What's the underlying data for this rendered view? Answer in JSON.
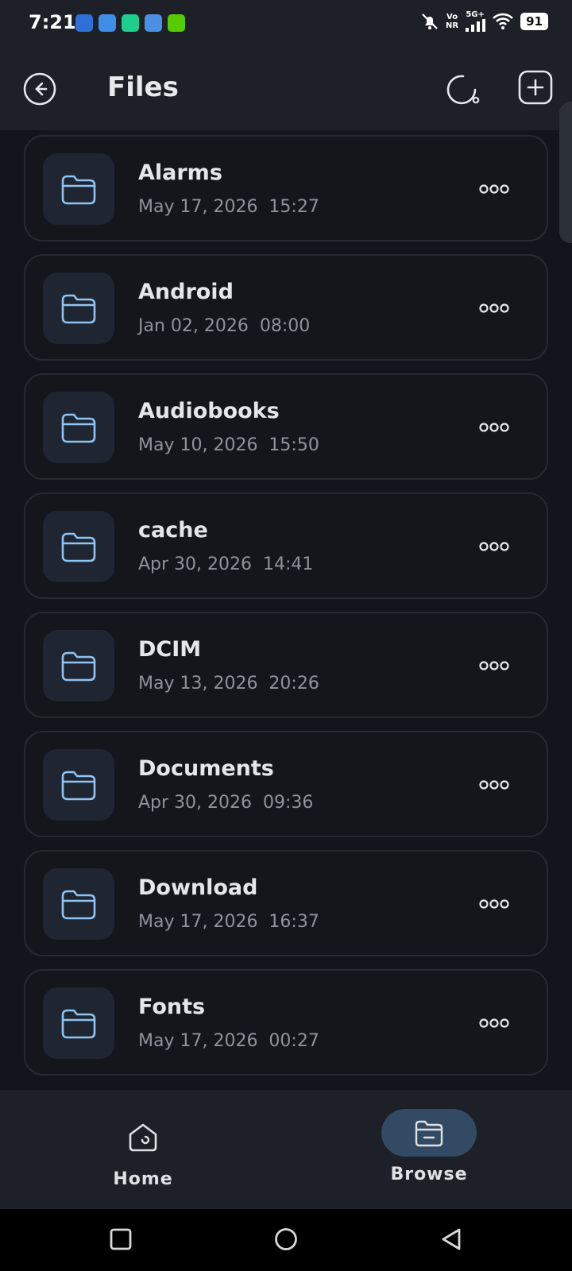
{
  "status_bar": {
    "time": "7:21",
    "notification_icons": [
      {
        "name": "usb-icon",
        "color": "#2f6fd6"
      },
      {
        "name": "browser-app-icon",
        "color": "#3f8ee8"
      },
      {
        "name": "maybe-app-icon",
        "color": "#1fce8e"
      },
      {
        "name": "files-app-icon",
        "color": "#4a90e2"
      },
      {
        "name": "duolingo-icon",
        "color": "#58cc02"
      }
    ],
    "network_top": "Vo",
    "network_bottom": "NR",
    "signal_label": "5G+",
    "battery": "91"
  },
  "app_bar": {
    "title": "Files"
  },
  "folders": [
    {
      "name": "Alarms",
      "date": "May 17, 2026  15:27"
    },
    {
      "name": "Android",
      "date": "Jan 02, 2026  08:00"
    },
    {
      "name": "Audiobooks",
      "date": "May 10, 2026  15:50"
    },
    {
      "name": "cache",
      "date": "Apr 30, 2026  14:41"
    },
    {
      "name": "DCIM",
      "date": "May 13, 2026  20:26"
    },
    {
      "name": "Documents",
      "date": "Apr 30, 2026  09:36"
    },
    {
      "name": "Download",
      "date": "May 17, 2026  16:37"
    },
    {
      "name": "Fonts",
      "date": "May 17, 2026  00:27"
    }
  ],
  "bottom_nav": {
    "home_label": "Home",
    "browse_label": "Browse",
    "active": "browse"
  },
  "colors": {
    "background": "#12151b",
    "accent_folder": "#8fc4f4",
    "active_nav_pill": "#324a63"
  }
}
